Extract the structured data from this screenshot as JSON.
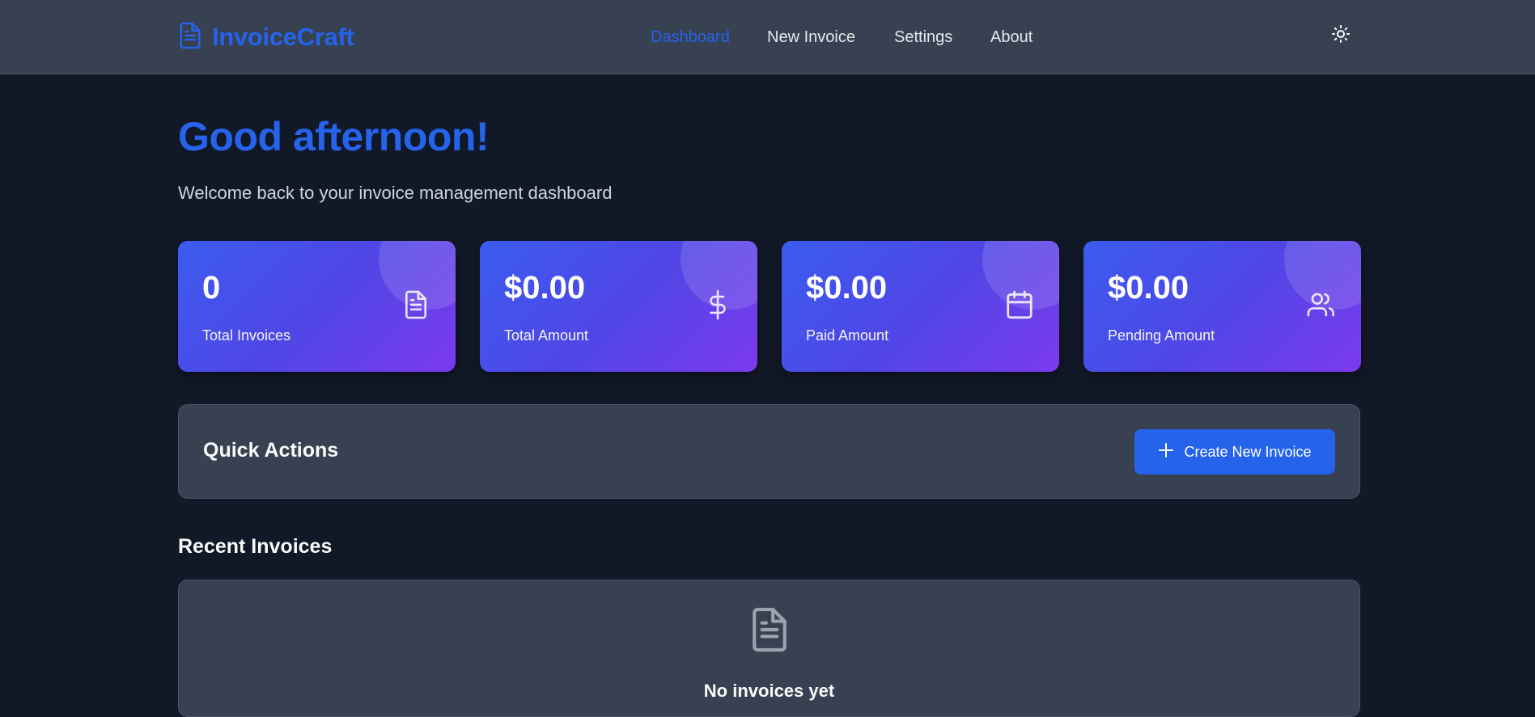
{
  "header": {
    "brand": "InvoiceCraft",
    "nav": [
      {
        "label": "Dashboard",
        "active": true
      },
      {
        "label": "New Invoice",
        "active": false
      },
      {
        "label": "Settings",
        "active": false
      },
      {
        "label": "About",
        "active": false
      }
    ],
    "theme_toggle_icon": "sun-icon"
  },
  "hero": {
    "greeting": "Good afternoon!",
    "subtitle": "Welcome back to your invoice management dashboard"
  },
  "stats": [
    {
      "value": "0",
      "label": "Total Invoices",
      "icon": "document-icon"
    },
    {
      "value": "$0.00",
      "label": "Total Amount",
      "icon": "dollar-icon"
    },
    {
      "value": "$0.00",
      "label": "Paid Amount",
      "icon": "calendar-icon"
    },
    {
      "value": "$0.00",
      "label": "Pending Amount",
      "icon": "users-icon"
    }
  ],
  "quick_actions": {
    "title": "Quick Actions",
    "create_button": "Create New Invoice",
    "create_button_icon": "plus-icon"
  },
  "recent_invoices": {
    "title": "Recent Invoices",
    "empty_icon": "document-icon",
    "empty_title": "No invoices yet"
  },
  "colors": {
    "accent": "#2563eb",
    "background": "#111827",
    "surface": "#374151",
    "card_gradient_start": "#3b5cf0",
    "card_gradient_end": "#7c3aed"
  }
}
